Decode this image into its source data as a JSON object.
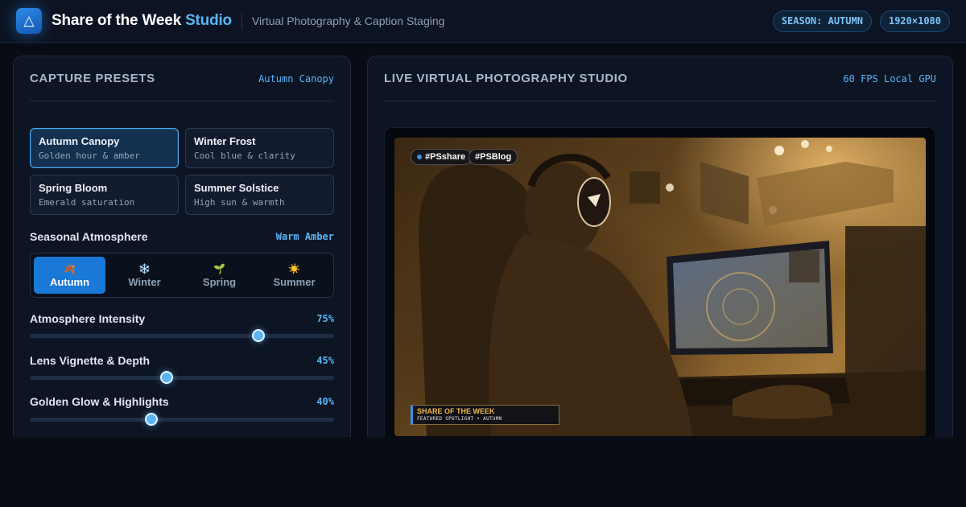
{
  "header": {
    "logo_glyph": "△",
    "title_main": "Share of the Week",
    "title_accent": "Studio",
    "subtitle": "Virtual Photography & Caption Staging",
    "badges": [
      "SEASON: AUTUMN",
      "1920×1080"
    ]
  },
  "left_panel": {
    "title": "CAPTURE PRESETS",
    "active_preset": "Autumn Canopy",
    "presets": [
      {
        "name": "Autumn Canopy",
        "desc": "Golden hour & amber"
      },
      {
        "name": "Winter Frost",
        "desc": "Cool blue & clarity"
      },
      {
        "name": "Spring Bloom",
        "desc": "Emerald saturation"
      },
      {
        "name": "Summer Solstice",
        "desc": "High sun & warmth"
      }
    ],
    "atmosphere": {
      "label": "Seasonal Atmosphere",
      "value": "Warm Amber",
      "options": [
        {
          "icon": "🍂",
          "icon_name": "leaf-icon",
          "label": "Autumn"
        },
        {
          "icon": "❄️",
          "icon_name": "snowflake-icon",
          "label": "Winter"
        },
        {
          "icon": "🌱",
          "icon_name": "sprout-icon",
          "label": "Spring"
        },
        {
          "icon": "☀️",
          "icon_name": "sun-icon",
          "label": "Summer"
        }
      ]
    },
    "sliders": [
      {
        "label": "Atmosphere Intensity",
        "value_text": "75%",
        "value": 75
      },
      {
        "label": "Lens Vignette & Depth",
        "value_text": "45%",
        "value": 45
      },
      {
        "label": "Golden Glow & Highlights",
        "value_text": "40%",
        "value": 40
      }
    ]
  },
  "right_panel": {
    "title": "LIVE VIRTUAL PHOTOGRAPHY STUDIO",
    "meta": "60 FPS Local GPU",
    "tags": [
      "#PSshare",
      "#PSBlog"
    ],
    "caption_title": "SHARE OF THE WEEK",
    "caption_sub": "FEATURED SPOTLIGHT • AUTUMN"
  },
  "colors": {
    "accent": "#5ab4f5",
    "active_season": "#1a78d6",
    "caption_gold": "#f0b84a"
  }
}
